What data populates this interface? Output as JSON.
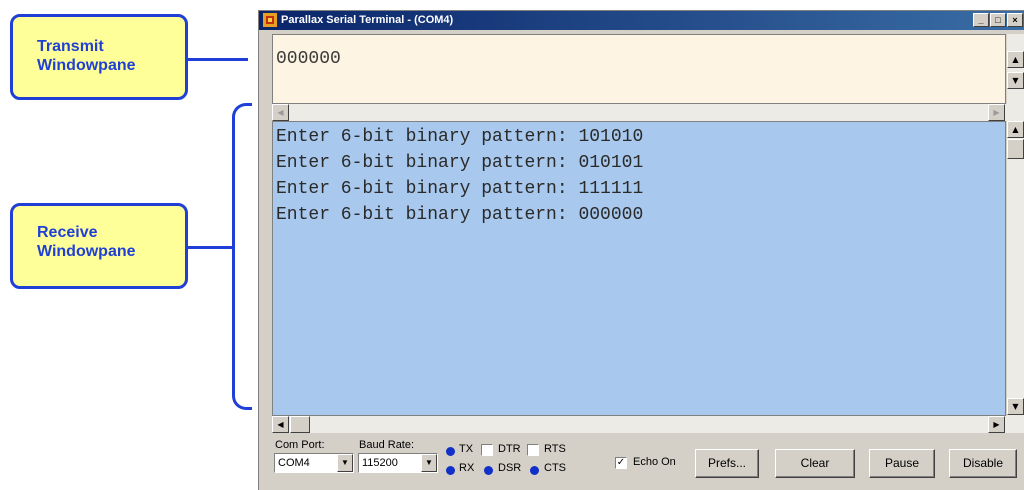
{
  "callouts": {
    "transmit": {
      "line1": "Transmit",
      "line2": "Windowpane"
    },
    "receive": {
      "line1": "Receive",
      "line2": "Windowpane"
    }
  },
  "window": {
    "title": "Parallax Serial Terminal - (COM4)",
    "controls": {
      "minimize": "_",
      "maximize": "□",
      "close": "×"
    }
  },
  "transmit_pane": {
    "text": "000000"
  },
  "receive_pane": {
    "lines": [
      "Enter 6-bit binary pattern: 101010",
      "Enter 6-bit binary pattern: 010101",
      "Enter 6-bit binary pattern: 111111",
      "Enter 6-bit binary pattern: 000000"
    ]
  },
  "scroll_icons": {
    "up": "▲",
    "down": "▼",
    "left": "◀",
    "right": "▶"
  },
  "bottom_bar": {
    "com_port_label": "Com Port:",
    "com_port_value": "COM4",
    "baud_rate_label": "Baud Rate:",
    "baud_rate_value": "115200",
    "indicators": {
      "tx": "TX",
      "rx": "RX",
      "dtr": "DTR",
      "rts": "RTS",
      "dsr": "DSR",
      "cts": "CTS"
    },
    "echo_on_label": "Echo On",
    "echo_on_checked": true,
    "buttons": {
      "prefs": "Prefs...",
      "clear": "Clear",
      "pause": "Pause",
      "disable": "Disable"
    }
  },
  "colors": {
    "callout_fill": "#ffff99",
    "callout_border": "#1f3fd6",
    "transmit_bg": "#fdf4e3",
    "receive_bg": "#a8c8ee",
    "indicator_dot": "#1030c8"
  }
}
